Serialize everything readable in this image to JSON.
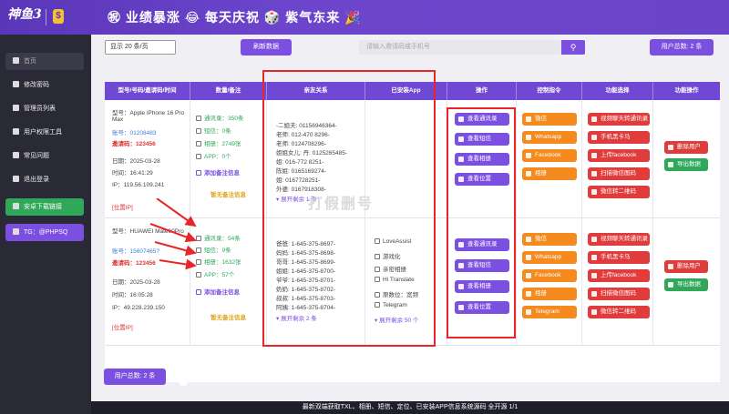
{
  "header": {
    "logo_text": "神鱼3",
    "banner": "㊗ 业绩暴涨 😂 每天庆祝 🎲 紫气东来 🎉"
  },
  "sidebar": {
    "items": [
      {
        "label": "首页"
      },
      {
        "label": "修改密码"
      },
      {
        "label": "管理员列表"
      },
      {
        "label": "用户权限工具"
      },
      {
        "label": "常见问题"
      },
      {
        "label": "退出登录"
      },
      {
        "label": "安卓下载链接"
      },
      {
        "label": "TG：@PHPSQ"
      }
    ]
  },
  "toolbar": {
    "page_size": "显示 20 条/页",
    "refresh_label": "刷新数据",
    "search_placeholder": "请输入邀请码或手机号",
    "users_label": "用户总数: 2 条"
  },
  "table": {
    "headers": [
      "型号/号码/邀请码/时间",
      "数量/备注",
      "亲友关系",
      "已安装App",
      "操作",
      "控制指令",
      "功能选择",
      "功能操作"
    ],
    "rows": [
      {
        "model": "型号：Apple iPhone 16 Pro Max",
        "phone": "账号：01208483",
        "invite": "邀请码：123456",
        "date": "日期：2025-03-28",
        "time": "时间：16:41:29",
        "ip": "IP：119.56.109.241",
        "ip_tag": "[位置IP]",
        "counts": [
          "通讯录：350条",
          "短信：0条",
          "相册：2749张",
          "APP：0个"
        ],
        "add_note": "添加备注信息",
        "no_note": "暂无备注信息",
        "contacts": [
          "-二姐夫: 01156946364-",
          "老师: 012-470 8296-",
          "老师: 0124708296-",
          "姐姐女儿: 丹: 0125265485-",
          "姐: 016-772 8251-",
          "陈姐: 0165169274-",
          "姐: 0167728251-",
          "外婆: 0167918308-"
        ],
        "contacts_more": "展开剩余 1 条",
        "apps": [],
        "apps_more": ""
      },
      {
        "model": "型号：HUAWEI Mate60Pro",
        "phone": "账号：15607465?",
        "invite": "邀请码：123456",
        "date": "日期：2025-03-28",
        "time": "时间：16:05:28",
        "ip": "IP：49.228.239.150",
        "ip_tag": "[位置IP]",
        "counts": [
          "通讯录：54条",
          "短信：9条",
          "相册：1632张",
          "APP：57个"
        ],
        "add_note": "添加备注信息",
        "no_note": "暂无备注信息",
        "contacts": [
          "爸爸: 1-645-375-8697-",
          "妈妈: 1-645-375-8698-",
          "哥哥: 1-645-375-8699-",
          "姐姐: 1-645-375-8700-",
          "爷爷: 1-645-375-8701-",
          "奶奶: 1-645-375-8702-",
          "叔叔: 1-645-375-8703-",
          "阿姨: 1-645-375-8704-"
        ],
        "contacts_more": "展开剩余 2 条",
        "apps": [
          "LoveAssist",
          "游戏化",
          "亲密相册",
          "Hi Translate",
          "原数位：宽频",
          "Telegram"
        ],
        "apps_more": "展开剩余 50 个"
      }
    ],
    "ops": [
      "查看通讯录",
      "查看短信",
      "查看相册",
      "查看位置"
    ],
    "commands_row1": [
      "微信",
      "Whatsapp",
      "Facebook",
      "相册"
    ],
    "commands_row2": [
      "微信",
      "Whatsapp",
      "Facebook",
      "相册",
      "Telegram"
    ],
    "functions_row1": [
      "视频聊天转通讯录",
      "手机黑卡马",
      "上传facebook",
      "扫描微信图码",
      "微信转二维码"
    ],
    "functions_row2": [
      "视频聊天转通讯录",
      "手机黑卡马",
      "上传facebook",
      "扫描微信图码",
      "微信转二维码"
    ],
    "actions": [
      "删除用户",
      "导出数据"
    ]
  },
  "watermark": "打假删号",
  "footer": {
    "users_label": "用户总数: 2 条",
    "bottom_text": "最新双端获取TXL、相册、短信、定位、已安装APP信息系统源码 全开源   1/1"
  },
  "colors": {
    "accent": "#6f48d4",
    "highlight": "#e8262a",
    "orange": "#f58a1f",
    "red": "#e03c3c",
    "green": "#2fa85a"
  }
}
